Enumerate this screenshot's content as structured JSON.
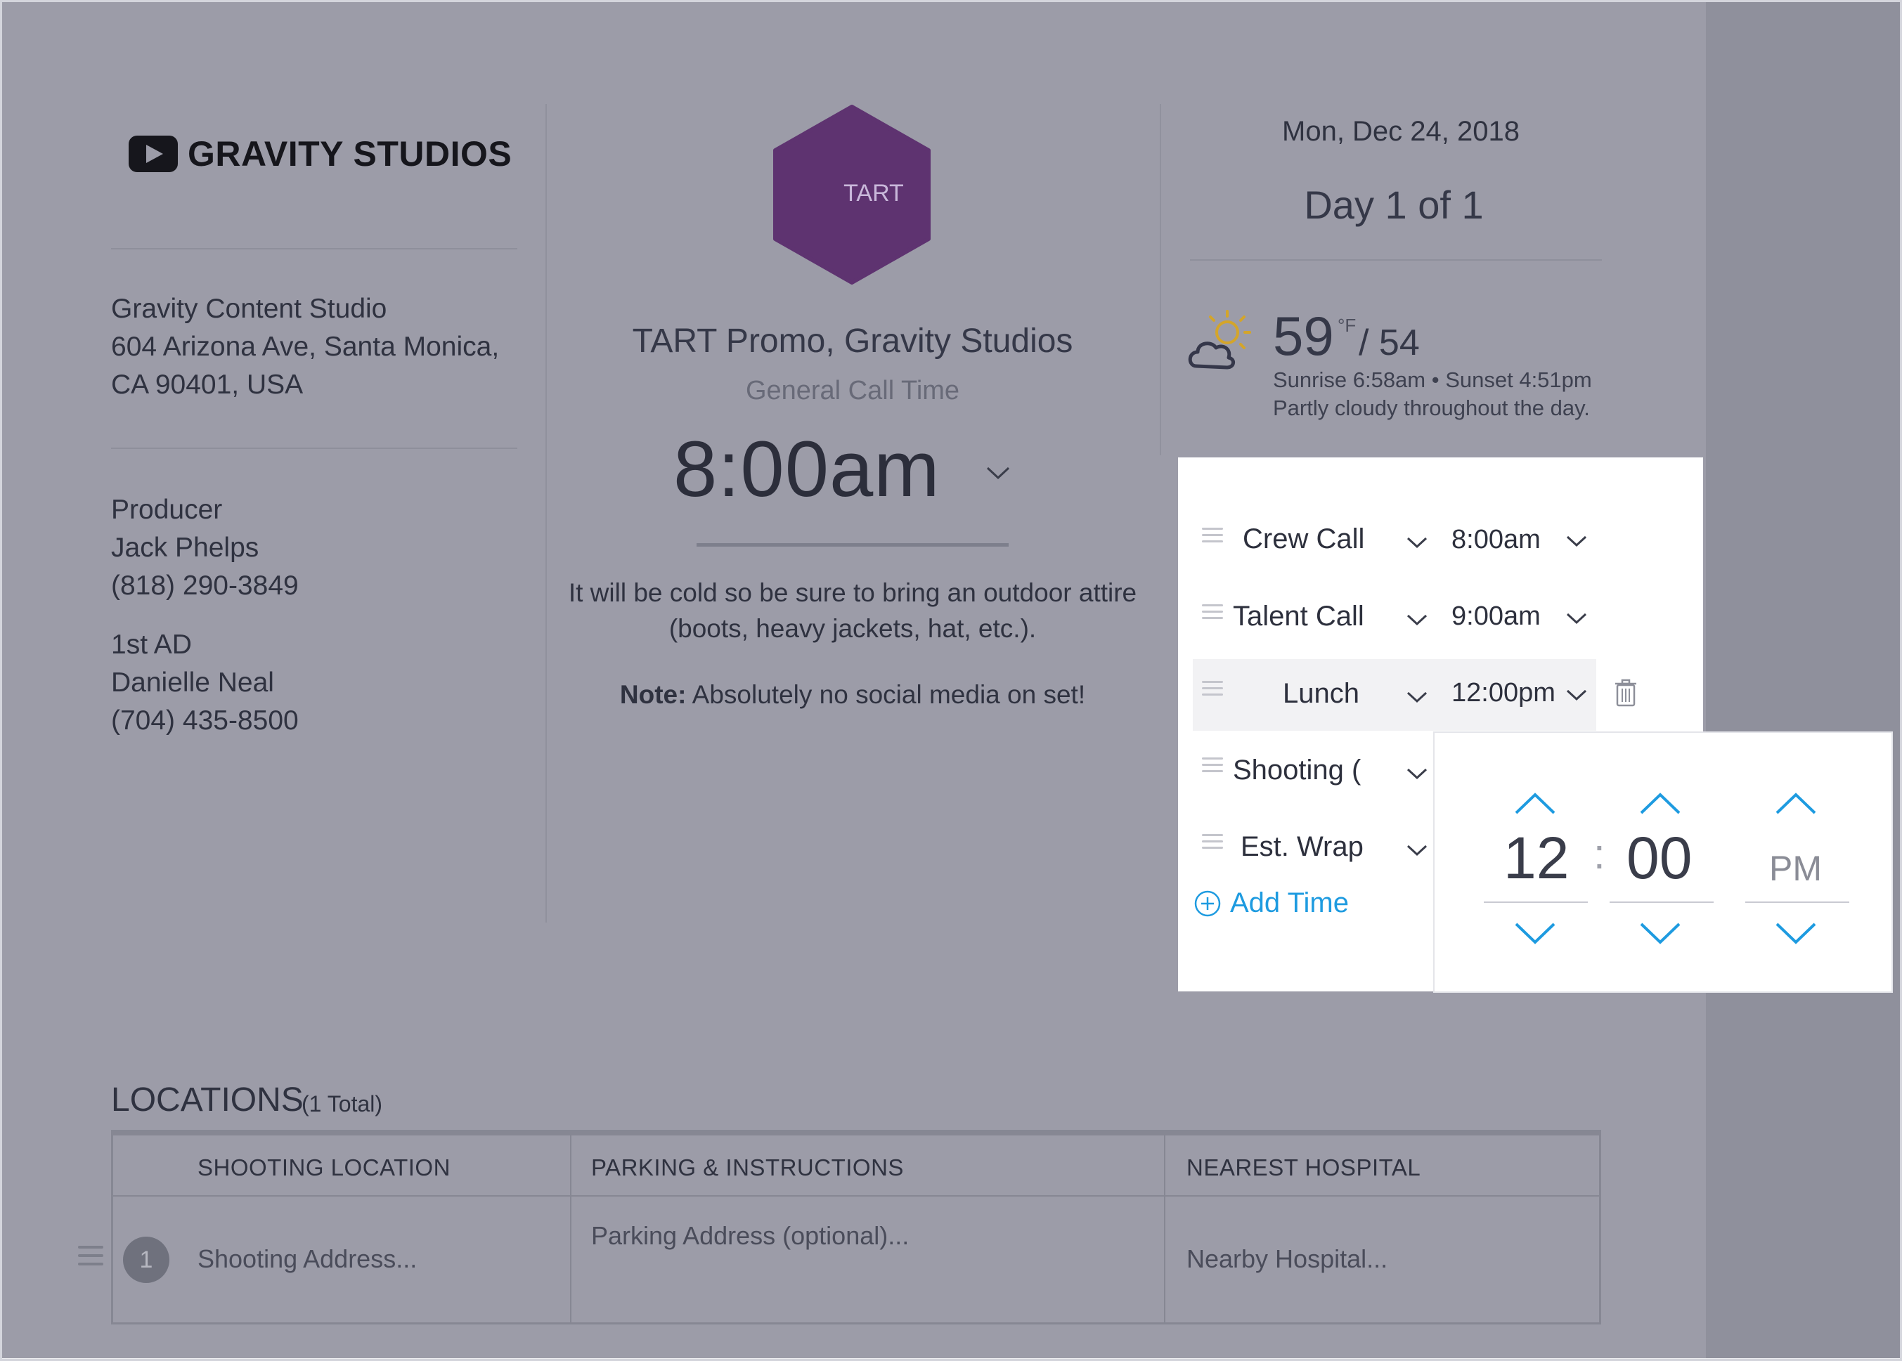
{
  "brand": {
    "logo_text": "GRAVITY STUDIOS"
  },
  "company": {
    "name": "Gravity Content Studio",
    "address_line1": "604 Arizona Ave, Santa Monica,",
    "address_line2": "CA 90401, USA"
  },
  "contacts": [
    {
      "role": "Producer",
      "name": "Jack Phelps",
      "phone": "(818) 290-3849"
    },
    {
      "role": "1st AD",
      "name": "Danielle Neal",
      "phone": "(704) 435-8500"
    }
  ],
  "project": {
    "badge_text": "TART",
    "badge_color": "#5e3370",
    "title": "TART Promo, Gravity Studios",
    "call_label": "General Call Time",
    "call_time": "8:00am",
    "note_text": "It will be cold so be sure to bring an outdoor attire (boots, heavy jackets, hat, etc.).",
    "note_bold": "Note:",
    "note_rest": " Absolutely no social media on set!"
  },
  "schedule": {
    "date": "Mon, Dec 24, 2018",
    "day_label": "Day 1 of 1"
  },
  "weather": {
    "icon": "partly-cloudy-icon",
    "high": "59",
    "unit": "°F",
    "low": "/ 54",
    "sun": "Sunrise 6:58am • Sunset 4:51pm",
    "summary": "Partly cloudy throughout the day."
  },
  "times": {
    "rows": [
      {
        "label": "Crew Call",
        "time": "8:00am"
      },
      {
        "label": "Talent Call",
        "time": "9:00am"
      },
      {
        "label": "Lunch",
        "time": "12:00pm"
      },
      {
        "label": "Shooting (",
        "time": ""
      },
      {
        "label": "Est. Wrap",
        "time": ""
      }
    ],
    "add_label": "Add Time",
    "accent": "#1e9be0"
  },
  "picker": {
    "hour": "12",
    "separator": ":",
    "minute": "00",
    "ampm": "PM"
  },
  "locations": {
    "title": "LOCATIONS",
    "count": "(1  Total)",
    "columns": [
      "SHOOTING LOCATION",
      "PARKING & INSTRUCTIONS",
      "NEAREST HOSPITAL"
    ],
    "row": {
      "number": "1",
      "shooting_placeholder": "Shooting Address...",
      "parking_placeholder": "Parking Address (optional)...",
      "hospital_placeholder": "Nearby Hospital..."
    }
  }
}
